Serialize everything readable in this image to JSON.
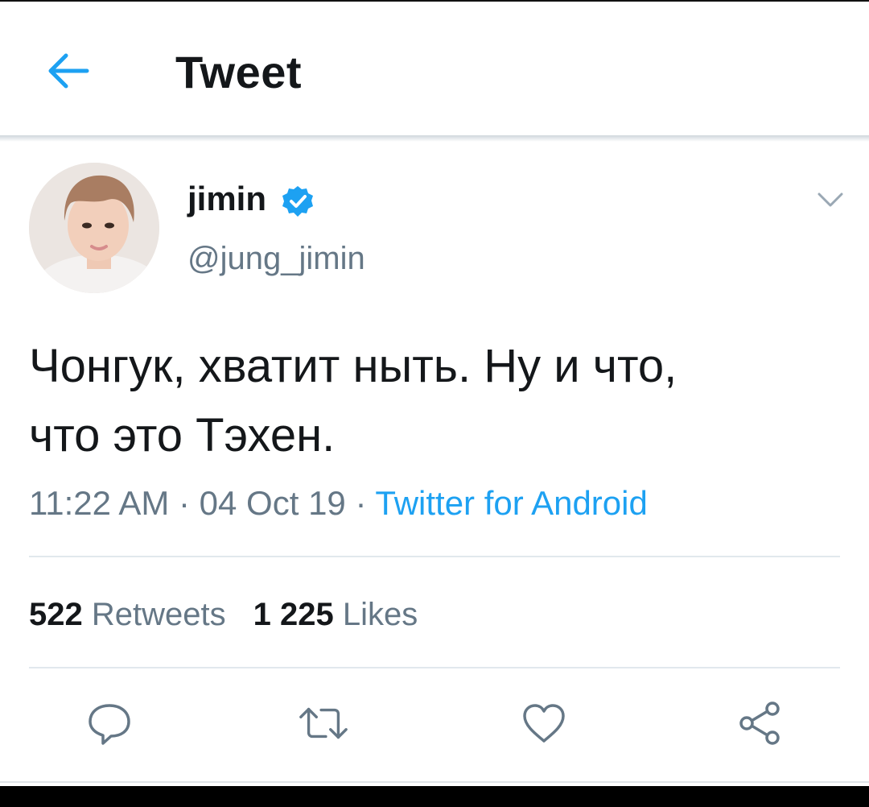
{
  "header": {
    "title": "Tweet",
    "back_icon": "arrow-left-icon"
  },
  "colors": {
    "accent": "#1da1f2",
    "text_primary": "#14171a",
    "text_secondary": "#657786",
    "divider": "#e1e8ed"
  },
  "tweet": {
    "author": {
      "name": "jimin",
      "handle": "@jung_jimin",
      "verified": true
    },
    "text": "Чонгук, хватит ныть. Ну и что,\nчто это Тэхен.",
    "time": "11:22 AM",
    "separator": " · ",
    "date": "04 Oct 19",
    "source": "Twitter for Android"
  },
  "stats": {
    "retweets_count": "522",
    "retweets_label": "Retweets",
    "likes_count": "1 225",
    "likes_label": "Likes"
  },
  "actions": [
    {
      "icon": "reply-icon"
    },
    {
      "icon": "retweet-icon"
    },
    {
      "icon": "like-icon"
    },
    {
      "icon": "share-icon"
    }
  ]
}
